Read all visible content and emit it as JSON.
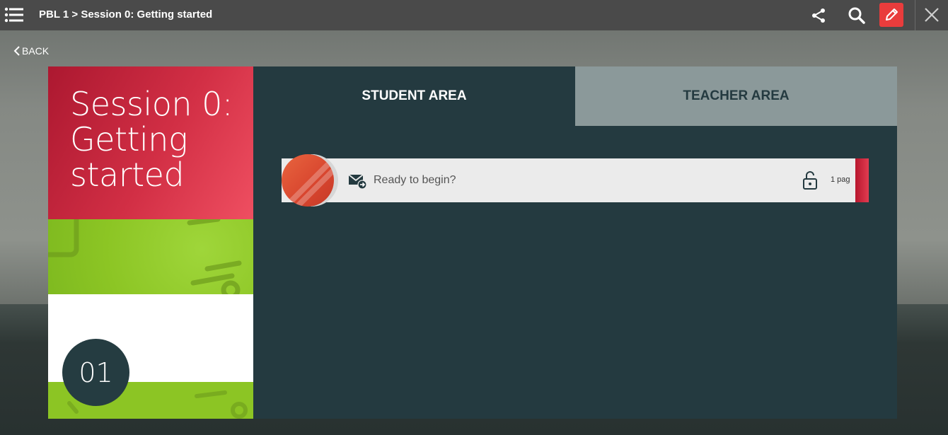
{
  "topbar": {
    "breadcrumb": "PBL 1 > Session 0: Getting started"
  },
  "nav": {
    "back_label": "BACK"
  },
  "session": {
    "title": "Session 0: Getting started",
    "number": "01"
  },
  "tabs": [
    {
      "label": "STUDENT AREA",
      "active": true
    },
    {
      "label": "TEACHER AREA",
      "active": false
    }
  ],
  "items": [
    {
      "label": "Ready to begin?",
      "pages": "1 pag",
      "icon": "mail-arrow-icon",
      "status_icon": "unlock-icon"
    }
  ],
  "colors": {
    "topbar": "#4a4a4a",
    "accent_red": "#e93c3c",
    "panel_dark": "#243a40",
    "teacher_tab": "#8b999a",
    "green": "#8cc524"
  }
}
